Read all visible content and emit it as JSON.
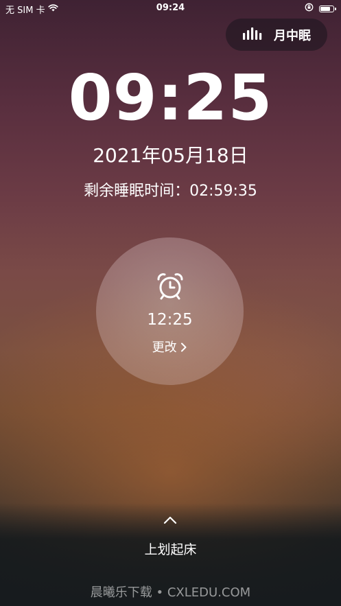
{
  "status_bar": {
    "carrier": "无 SIM 卡",
    "time": "09:24",
    "battery_level_percent": 85,
    "icons": [
      "wifi-icon",
      "orientation-lock-icon",
      "battery-icon"
    ]
  },
  "mode": {
    "label": "月中眠",
    "icon": "sound-bars-icon"
  },
  "clock": {
    "time": "09:25",
    "date": "2021年05月18日",
    "remaining": "剩余睡眠时间：02:59:35"
  },
  "alarm": {
    "icon": "alarm-clock-icon",
    "time": "12:25",
    "change_label": "更改"
  },
  "swipe": {
    "icon": "chevron-up-icon",
    "label": "上划起床"
  },
  "watermark": "晨曦乐下载 • CXLEDU.COM"
}
